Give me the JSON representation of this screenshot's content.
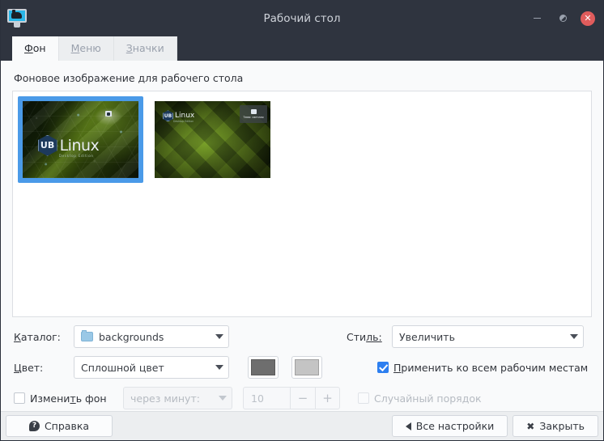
{
  "window": {
    "title": "Рабочий стол",
    "app_icon": "monitor-icon",
    "controls": {
      "minimize": "minimize-icon",
      "maximize": "maximize-icon",
      "close": "close-icon"
    }
  },
  "tabs": [
    {
      "label": "Фон",
      "mnemonic": "Ф",
      "rest": "он",
      "active": true
    },
    {
      "label": "Меню",
      "mnemonic": "М",
      "rest": "еню",
      "active": false
    },
    {
      "label": "Значки",
      "mnemonic": "З",
      "rest": "начки",
      "active": false
    }
  ],
  "main": {
    "section_label": "Фоновое изображение для рабочего стола",
    "wallpapers": [
      {
        "name": "UB Linux Desktop Edition",
        "selected": true
      },
      {
        "name": "UB Linux green ribbons",
        "selected": false
      }
    ],
    "wallpaper_logo": {
      "badge": "UB",
      "word": "Linux",
      "subtitle": "Desktop Edition"
    },
    "wallpaper2_panel_caption": "Тема: светлая"
  },
  "form": {
    "directory": {
      "label_prefix": "К",
      "label_rest": "аталог:",
      "value": "backgrounds",
      "icon": "folder-icon"
    },
    "style": {
      "label_prefix": "Сти",
      "label_rest": "ль:",
      "value": "Увеличить"
    },
    "color": {
      "label_prefix": "Ц",
      "label_rest": "вет:",
      "value": "Сплошной цвет",
      "swatch1": "#6e6e6e",
      "swatch2": "#c4c4c4"
    },
    "apply_all_workspaces": {
      "label_prefix": "П",
      "label_rest": "рименить ко всем рабочим местам",
      "checked": true
    },
    "change_background": {
      "label_prefix": "Измени",
      "label_mnemonic": "т",
      "label_rest": "ь фон",
      "checked": false
    },
    "interval": {
      "value": "через минут:",
      "disabled": true
    },
    "spinner": {
      "value": "10",
      "minus": "−",
      "plus": "+",
      "disabled": true
    },
    "random_order": {
      "label": "Случайный порядок",
      "checked": false,
      "disabled": true
    }
  },
  "bottom": {
    "help": "Справка",
    "all_settings": "Все настройки",
    "close": "Закрыть"
  },
  "colors": {
    "titlebar": "#2f343f",
    "accent": "#2d7ff0",
    "selection": "#4a9ae8",
    "close_button": "#e05c5c"
  }
}
